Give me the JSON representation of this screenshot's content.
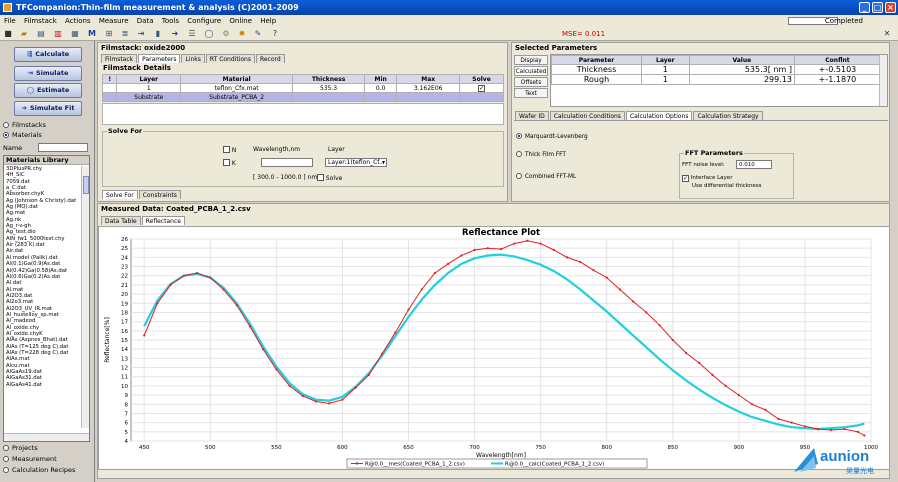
{
  "window": {
    "title": "TFCompanion:Thin-film measurement & analysis (C)2001-2009"
  },
  "menu": [
    "File",
    "Filmstack",
    "Actions",
    "Measure",
    "Data",
    "Tools",
    "Configure",
    "Online",
    "Help"
  ],
  "status": {
    "completed_label": "Completed",
    "mse_label": "MSE= 0.011"
  },
  "left": {
    "buttons": {
      "calculate": "Calculate",
      "simulate": "Simulate",
      "estimate": "Estimate",
      "simulate_fit": "Simulate Fit"
    },
    "radios": {
      "filmstacks": "Filmstacks",
      "materials": "Materials",
      "projects": "Projects",
      "measurement": "Measurement",
      "calc_recipes": "Calculation Recipes"
    },
    "name_label": "Name",
    "library_title": "Materials Library",
    "materials": [
      "3DPlusPR.chy",
      "4H_SiC",
      "7059.dat",
      "a_C.dat",
      "Absorber.chyK",
      "Ag (Johnson & Christy).dat",
      "Ag (MQ).dat",
      "Ag.mat",
      "Ag.nk",
      "Ag_r-v-gh",
      "Ag_test.dio",
      "AlN_fw1_5000test.chy",
      "Air (283 K).dat",
      "Air.dat",
      "Al model (Palik).dat",
      "Al(0.1)Ga(0.9)As.dat",
      "Al(0.42)Ga(0.58)As.dat",
      "Al(0.6)Ga(0.2)As.dat",
      "Al.dat",
      "Al.mat",
      "Al2O3.dat",
      "Al2o3.mat",
      "Al2O3_UV_IR.mat",
      "Al_hustelloy_sp.mat",
      "Al_madeod",
      "Al_oxide.chy",
      "Al_oxide.chyK",
      "AlAs (Aspnes_Bhat).dat",
      "AlAs (T=125 deg C).dat",
      "AlAs (T=228 deg C).dat",
      "AlAs.mat",
      "Alcu.mat",
      "AlGaAs19.dat",
      "AlGaAs31.dat",
      "AlGaAs41.dat"
    ]
  },
  "filmstack": {
    "title": "Filmstack: oxide2000",
    "tabs": [
      "Filmstack",
      "Parameters",
      "Links",
      "RT Conditions",
      "Record"
    ],
    "details_title": "Filmstack Details",
    "columns": [
      "!",
      "Layer",
      "Material",
      "Thickness",
      "Min",
      "Max",
      "Solve"
    ],
    "rows": [
      {
        "excl": "",
        "layer": "1",
        "material": "teflon_Cfx.mat",
        "thickness": "535.3",
        "min": "0.0",
        "max": "3.162E06",
        "solve": "✓"
      },
      {
        "excl": "",
        "layer": "Substrate",
        "material": "Substrate_PCBA_2",
        "thickness": "",
        "min": "",
        "max": "",
        "solve": ""
      }
    ]
  },
  "solvefor": {
    "title": "Solve For",
    "n_label": "N",
    "k_label": "K",
    "wavelength_label": "Wavelength,nm",
    "layer_label": "Layer",
    "layer_value": "Layer:1(teflon_Cf...",
    "range_label": "[ 300.0 - 1000.0 ] nm",
    "solve_label": "Solve",
    "tabs": [
      "Solve For",
      "Constraints"
    ]
  },
  "selected": {
    "title": "Selected Parameters",
    "side_buttons": [
      "Display",
      "Calculated",
      "Offsets",
      "Text"
    ],
    "columns": [
      "Parameter",
      "Layer",
      "Value",
      "Conflnt"
    ],
    "rows": [
      {
        "param": "Thickness",
        "layer": "1",
        "value": "535.3[ nm ]",
        "conf": "+-0.5103"
      },
      {
        "param": "Rough",
        "layer": "1",
        "value": "299.13",
        "conf": "+-1.1870"
      }
    ],
    "tabs": [
      "Wafer ID",
      "Calculation Conditions",
      "Calculation Options",
      "Calculation Strategy"
    ],
    "options": {
      "marquardt": "Marquardt-Levenberg",
      "thickfilm": "Thick Film FFT",
      "combined": "Combined FFT-ML"
    },
    "fft": {
      "title": "FFT Parameters",
      "noise_label": "FFT noise level:",
      "noise_value": "0.010",
      "interface_label": "Interface Layer",
      "diff_label": "Use differential thickness"
    }
  },
  "measured": {
    "title": "Measured Data: Coated_PCBA_1_2.csv",
    "tabs": [
      "Data Table",
      "Reflectance"
    ]
  },
  "chart_data": {
    "type": "line",
    "title": "Reflectance Plot",
    "xlabel": "Wavelength[nm]",
    "ylabel": "Reflectance[%]",
    "xlim": [
      440,
      1000
    ],
    "ylim": [
      4,
      26
    ],
    "xticks": [
      450,
      500,
      550,
      600,
      650,
      700,
      750,
      800,
      850,
      900,
      950,
      1000
    ],
    "yticks": [
      4,
      5,
      6,
      7,
      8,
      9,
      10,
      11,
      12,
      13,
      14,
      15,
      16,
      17,
      18,
      19,
      20,
      21,
      22,
      23,
      24,
      25,
      26
    ],
    "grid": true,
    "legend_position": "bottom",
    "colors": {
      "measured": "#e02020",
      "calculated": "#20d0e0"
    },
    "series": [
      {
        "name": "R@0.0__mes(Coated_PCBA_1_2.csv)",
        "x": [
          450,
          460,
          470,
          480,
          490,
          500,
          510,
          520,
          530,
          540,
          550,
          560,
          570,
          580,
          590,
          600,
          610,
          620,
          630,
          640,
          650,
          660,
          670,
          680,
          690,
          700,
          710,
          720,
          730,
          740,
          750,
          760,
          770,
          780,
          790,
          800,
          810,
          820,
          830,
          840,
          850,
          860,
          870,
          880,
          890,
          900,
          910,
          920,
          930,
          940,
          950,
          960,
          970,
          980,
          990,
          995
        ],
        "y": [
          15.5,
          19.0,
          21.0,
          22.0,
          22.3,
          21.8,
          20.5,
          18.8,
          16.5,
          14.0,
          11.8,
          10.0,
          8.9,
          8.3,
          8.1,
          8.5,
          9.8,
          11.2,
          13.5,
          15.8,
          18.3,
          20.5,
          22.3,
          23.3,
          24.2,
          24.8,
          25.0,
          24.9,
          25.5,
          25.8,
          25.5,
          24.8,
          24.0,
          23.5,
          22.6,
          21.8,
          20.5,
          19.2,
          18.0,
          16.6,
          15.0,
          13.6,
          12.5,
          11.2,
          10.0,
          9.0,
          8.0,
          7.4,
          6.4,
          6.0,
          5.6,
          5.3,
          5.2,
          5.3,
          5.0,
          4.6
        ]
      },
      {
        "name": "R@0.0__calc(Coated_PCBA_1_2.csv)",
        "x": [
          450,
          460,
          470,
          480,
          490,
          500,
          510,
          520,
          530,
          540,
          550,
          560,
          570,
          580,
          590,
          600,
          610,
          620,
          630,
          640,
          650,
          660,
          670,
          680,
          690,
          700,
          710,
          720,
          730,
          740,
          750,
          760,
          770,
          780,
          790,
          800,
          810,
          820,
          830,
          840,
          850,
          860,
          870,
          880,
          890,
          900,
          910,
          920,
          930,
          940,
          950,
          960,
          970,
          980,
          990,
          995
        ],
        "y": [
          16.5,
          19.3,
          21.1,
          22.0,
          22.2,
          21.8,
          20.7,
          19.0,
          16.8,
          14.3,
          12.1,
          10.3,
          9.1,
          8.5,
          8.4,
          8.8,
          9.9,
          11.4,
          13.3,
          15.4,
          17.5,
          19.4,
          21.0,
          22.3,
          23.3,
          23.9,
          24.2,
          24.3,
          24.1,
          23.7,
          23.2,
          22.5,
          21.6,
          20.5,
          19.3,
          18.1,
          16.8,
          15.5,
          14.2,
          12.9,
          11.7,
          10.6,
          9.6,
          8.7,
          7.9,
          7.2,
          6.6,
          6.2,
          5.8,
          5.5,
          5.4,
          5.3,
          5.4,
          5.5,
          5.7,
          5.9
        ]
      }
    ]
  },
  "brand": {
    "name": "aunion",
    "sub": "昊量光电"
  }
}
